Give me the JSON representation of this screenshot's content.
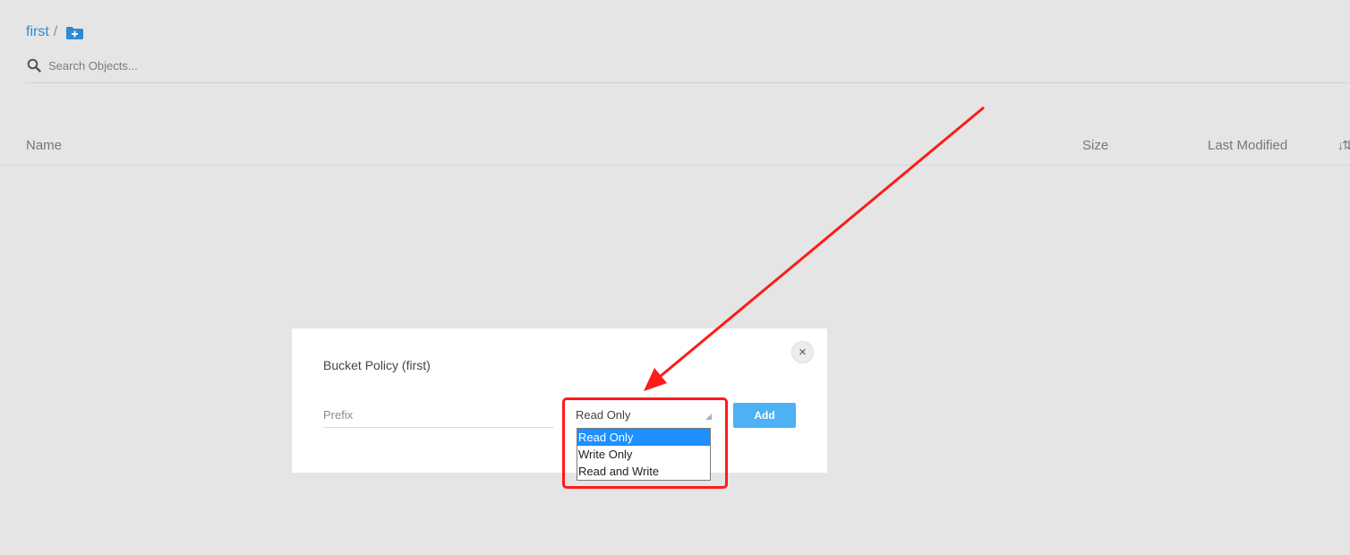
{
  "breadcrumb": {
    "bucket": "first",
    "separator": "/",
    "new_folder_icon": "folder-plus-icon"
  },
  "search": {
    "placeholder": "Search Objects...",
    "value": "",
    "icon": "search-icon"
  },
  "table": {
    "columns": {
      "name": "Name",
      "size": "Size",
      "last_modified": "Last Modified"
    },
    "sort_icon": "↓⇅"
  },
  "modal": {
    "title": "Bucket Policy (first)",
    "close_glyph": "×",
    "prefix_placeholder": "Prefix",
    "select_value": "Read Only",
    "add_label": "Add",
    "options": [
      "Read Only",
      "Write Only",
      "Read and Write"
    ],
    "selected_option": "Read Only"
  },
  "colors": {
    "background": "#e5e5e5",
    "link": "#2f8ad1",
    "add_button": "#4db1f3",
    "option_highlight": "#1e90ff",
    "annotation": "#ff1a1a"
  }
}
